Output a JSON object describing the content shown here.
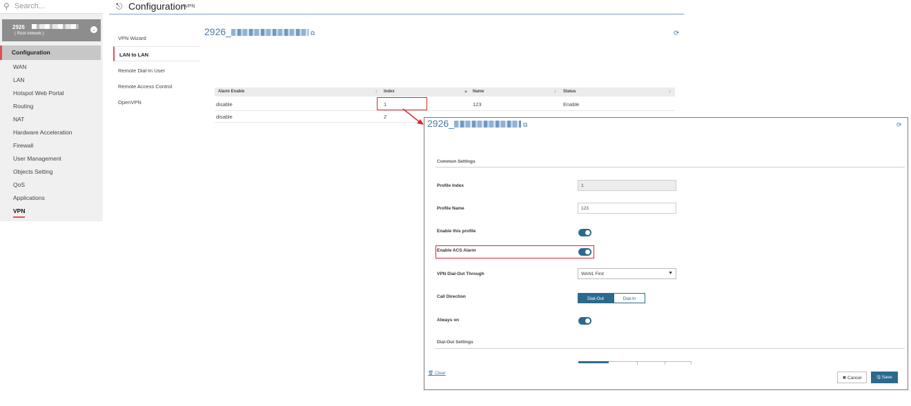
{
  "search": {
    "placeholder": "Search..."
  },
  "device": {
    "name": "2926",
    "subtitle": "( Root network )"
  },
  "sidebar": {
    "section": "Configuration",
    "items": [
      "WAN",
      "LAN",
      "Hotspot Web Portal",
      "Routing",
      "NAT",
      "Hardware Acceleration",
      "Firewall",
      "User Management",
      "Objects Setting",
      "QoS",
      "Applications",
      "VPN"
    ]
  },
  "header": {
    "title": "Configuration",
    "breadcrumb": ">VPN"
  },
  "submenu": [
    "VPN Wizard",
    "LAN to LAN",
    "Remote Dial-In User",
    "Remote Access Control",
    "OpenVPN"
  ],
  "main": {
    "title_prefix": "2926_"
  },
  "table": {
    "columns": [
      "Alarm Enable",
      "Index",
      "Name",
      "Status"
    ],
    "rows": [
      [
        "disable",
        "1",
        "123",
        "Enable"
      ],
      [
        "disable",
        "2",
        "",
        ""
      ]
    ]
  },
  "detail": {
    "title_prefix": "2926_",
    "common_settings": "Common Settings",
    "profile_index_label": "Profile Index",
    "profile_index_value": "1",
    "profile_name_label": "Profile Name",
    "profile_name_value": "123",
    "enable_profile_label": "Enable this profile",
    "enable_acs_label": "Enable ACS Alarm",
    "dialout_through_label": "VPN Dial-Out Through",
    "dialout_through_value": "WAN1 First",
    "call_direction_label": "Call Direction",
    "call_direction_options": [
      "Dial-Out",
      "Dial-In"
    ],
    "always_on_label": "Always on",
    "dialout_settings": "Dial-Out Settings",
    "clear_label": "Clear",
    "cancel_label": "Cancel",
    "save_label": "Save"
  },
  "colors": {
    "accent": "#2b6a8d",
    "highlight": "#d9262e",
    "link": "#4a78a7"
  }
}
